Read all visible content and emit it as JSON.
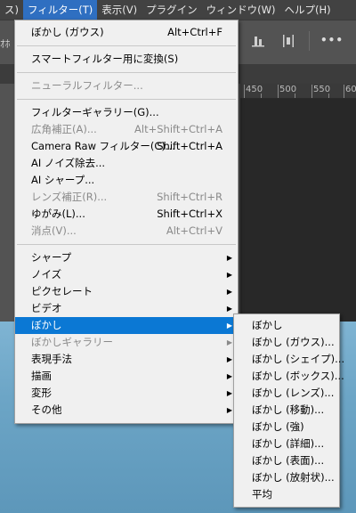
{
  "menubar": {
    "items": [
      "ス)",
      "フィルター(T)",
      "表示(V)",
      "プラグイン",
      "ウィンドウ(W)",
      "ヘルプ(H)"
    ],
    "active_index": 1
  },
  "optbar": {
    "cut_text": "ｵﾎ",
    "more_label": "•••"
  },
  "ruler": {
    "labels": [
      "450",
      "500",
      "550",
      "60"
    ]
  },
  "filter_menu": {
    "items": [
      {
        "label": "ぼかし (ガウス)",
        "shortcut": "Alt+Ctrl+F",
        "state": "enabled"
      },
      {
        "label": "スマートフィルター用に変換(S)",
        "shortcut": "",
        "state": "enabled"
      },
      {
        "label": "ニューラルフィルター...",
        "shortcut": "",
        "state": "disabled"
      },
      {
        "label": "フィルターギャラリー(G)...",
        "shortcut": "",
        "state": "enabled"
      },
      {
        "label": "広角補正(A)...",
        "shortcut": "Alt+Shift+Ctrl+A",
        "state": "disabled"
      },
      {
        "label": "Camera Raw フィルター(C)...",
        "shortcut": "Shift+Ctrl+A",
        "state": "enabled"
      },
      {
        "label": "AI ノイズ除去...",
        "shortcut": "",
        "state": "enabled"
      },
      {
        "label": "AI シャープ...",
        "shortcut": "",
        "state": "enabled"
      },
      {
        "label": "レンズ補正(R)...",
        "shortcut": "Shift+Ctrl+R",
        "state": "disabled"
      },
      {
        "label": "ゆがみ(L)...",
        "shortcut": "Shift+Ctrl+X",
        "state": "enabled"
      },
      {
        "label": "消点(V)...",
        "shortcut": "Alt+Ctrl+V",
        "state": "disabled"
      },
      {
        "label": "シャープ",
        "shortcut": "",
        "state": "submenu"
      },
      {
        "label": "ノイズ",
        "shortcut": "",
        "state": "submenu"
      },
      {
        "label": "ピクセレート",
        "shortcut": "",
        "state": "submenu"
      },
      {
        "label": "ビデオ",
        "shortcut": "",
        "state": "submenu"
      },
      {
        "label": "ぼかし",
        "shortcut": "",
        "state": "submenu-highlighted"
      },
      {
        "label": "ぼかしギャラリー",
        "shortcut": "",
        "state": "submenu-disabled"
      },
      {
        "label": "表現手法",
        "shortcut": "",
        "state": "submenu"
      },
      {
        "label": "描画",
        "shortcut": "",
        "state": "submenu"
      },
      {
        "label": "変形",
        "shortcut": "",
        "state": "submenu"
      },
      {
        "label": "その他",
        "shortcut": "",
        "state": "submenu"
      }
    ]
  },
  "blur_submenu": {
    "items": [
      "ぼかし",
      "ぼかし (ガウス)...",
      "ぼかし (シェイプ)...",
      "ぼかし (ボックス)...",
      "ぼかし (レンズ)...",
      "ぼかし (移動)...",
      "ぼかし (強)",
      "ぼかし (詳細)...",
      "ぼかし (表面)...",
      "ぼかし (放射状)...",
      "平均"
    ]
  },
  "colors": {
    "highlight": "#0b78d4",
    "menu_bg": "#f0f0f0",
    "menubar_active": "#2f6fc1"
  }
}
